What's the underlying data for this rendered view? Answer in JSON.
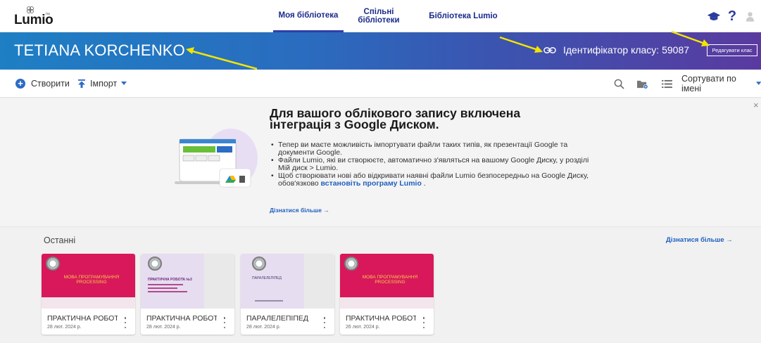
{
  "app": {
    "logo_text": "Lumio",
    "logo_tm": "™"
  },
  "nav": {
    "tabs": [
      {
        "label": "Моя бібліотека",
        "active": true
      },
      {
        "label": "Спільні бібліотеки",
        "active": false
      },
      {
        "label": "Бібліотека Lumio",
        "active": false
      }
    ],
    "icons": [
      "graduation-cap-icon",
      "help-icon",
      "user-icon"
    ],
    "help_symbol": "?"
  },
  "banner": {
    "name": "TETIANA KORCHENKO",
    "class_id_label": "Ідентифікатор класу: 59087",
    "edit_class_label": "Редагувати клас"
  },
  "toolbar": {
    "create_label": "Створити",
    "create_symbol": "+",
    "import_label": "Імпорт",
    "sort_label": "Сортувати по імені"
  },
  "info": {
    "close_symbol": "×",
    "title": "Для вашого облікового запису включена інтеграція з Google Диском.",
    "bullets": [
      "Тепер ви маєте можливість імпортувати файли таких типів, як презентації Google та документи Google.",
      "Файли Lumio, які ви створюєте, автоматично з'являться на вашому Google Диску, у розділі Мій диск > Lumio."
    ],
    "bullet3_before": "Щоб створювати нові або відкривати наявні файли Lumio безпосередньо на Google Диску, обов'язково ",
    "bullet3_link": "встановіть програму Lumio",
    "bullet3_after": " .",
    "learn_more": "Дізнатися більше →"
  },
  "recent": {
    "label": "Останні",
    "learn_more": "Дізнатися більше →",
    "cards": [
      {
        "title": "ПРАКТИЧНА РОБОТ...",
        "date": "28 лют. 2024 р.",
        "thumb_title": "МОВА ПРОГРАМУВАННЯ PROCESSING",
        "thumb_color": "#d8185a"
      },
      {
        "title": "ПРАКТИЧНА РОБОТ...",
        "date": "28 лют. 2024 р.",
        "thumb_title": "ПРАКТИЧНА РОБОТА №3",
        "thumb_color": "#e6ddf0"
      },
      {
        "title": "ПАРАЛЕЛЕПІПЕД",
        "date": "28 лют. 2024 р.",
        "thumb_title": "ПАРАЛЕЛЕПІПЕД",
        "thumb_color": "#e6ddf0"
      },
      {
        "title": "ПРАКТИЧНА РОБОТ...",
        "date": "26 лют. 2024 р.",
        "thumb_title": "МОВА ПРОГРАМУВАННЯ PROCESSING",
        "thumb_color": "#d8185a"
      }
    ]
  },
  "colors": {
    "accent": "#1f5fbf",
    "nav_text": "#1a2a8a",
    "card_pink": "#d8185a",
    "card_lavender": "#e6ddf0",
    "annotation_arrow": "#f2e500"
  }
}
